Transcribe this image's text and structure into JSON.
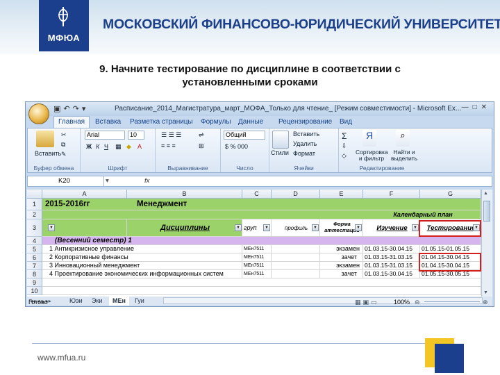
{
  "slide": {
    "logo_text": "МФЮА",
    "university": "МОСКОВСКИЙ ФИНАНСОВО-ЮРИДИЧЕСКИЙ УНИВЕРСИТЕТ",
    "title_line1": "9. Начните тестирование по дисциплине в соответствии с",
    "title_line2": "установленными сроками",
    "footer_url": "www.mfua.ru"
  },
  "excel": {
    "window_title": "Расписание_2014_Магистратура_март_МОФА_Только для чтение_ [Режим совместимости] - Microsoft Ex...",
    "tabs": [
      "Главная",
      "Вставка",
      "Разметка страницы",
      "Формулы",
      "Данные",
      "Рецензирование",
      "Вид"
    ],
    "ribbon": {
      "paste_label": "Вставить",
      "font_name": "Arial",
      "font_size": "10",
      "number_format": "Общий",
      "insert_label": "Вставить",
      "delete_label": "Удалить",
      "format_label": "Формат",
      "styles_label": "Стили",
      "sort_label": "Сортировка и фильтр",
      "find_label": "Найти и выделить",
      "groups": [
        "Буфер обмена",
        "Шрифт",
        "Выравнивание",
        "Число",
        "Ячейки",
        "Редактирование"
      ]
    },
    "formula_bar": {
      "name_box": "K20",
      "fx": "fx"
    },
    "columns": [
      "A",
      "B",
      "C",
      "D",
      "E",
      "F",
      "G"
    ],
    "rows": [
      {
        "num": "1",
        "a": "2015-2016гг",
        "b": "Менеджмент"
      },
      {
        "num": "2",
        "f": "Календарный план"
      },
      {
        "num": "3",
        "b": "Дисциплины",
        "c": "груп",
        "d": "профиль",
        "e": "Форма аттестации",
        "f": "Изучение",
        "g": "Тестирование"
      },
      {
        "num": "4",
        "a": "(Весенний семестр) 1"
      },
      {
        "num": "5",
        "a": "1 Антикризисное управление",
        "c": "МЕн7511",
        "e": "экзамен",
        "f": "01.03.15-30.04.15",
        "g": "01.05.15-01.05.15"
      },
      {
        "num": "6",
        "a": "2 Корпоративные финансы",
        "c": "МЕн7511",
        "e": "зачет",
        "f": "01.03.15-31.03.15",
        "g": "01.04.15-30.04.15"
      },
      {
        "num": "7",
        "a": "3 Инновационный менеджмент",
        "c": "МЕн7511",
        "e": "экзамен",
        "f": "01.03.15-31.03.15",
        "g": "01.04.15-30.04.15"
      },
      {
        "num": "8",
        "a": "4 Проектирование экономических информационных систем",
        "c": "МЕн7511",
        "e": "зачет",
        "f": "01.03.15-30.04.15",
        "g": "01.05.15-30.05.15"
      },
      {
        "num": "9",
        "a": ""
      },
      {
        "num": "10",
        "a": ""
      }
    ],
    "sheet_tabs": [
      "Юэи",
      "Эки",
      "МЕн",
      "Гуи"
    ],
    "status": "Готово",
    "zoom": "100%"
  },
  "colors": {
    "brand_blue": "#1b3f8c",
    "brand_yellow": "#f3c625",
    "header_green": "#9bd36a",
    "semester_lilac": "#d6b5ee",
    "highlight_red": "#d31e1e"
  }
}
